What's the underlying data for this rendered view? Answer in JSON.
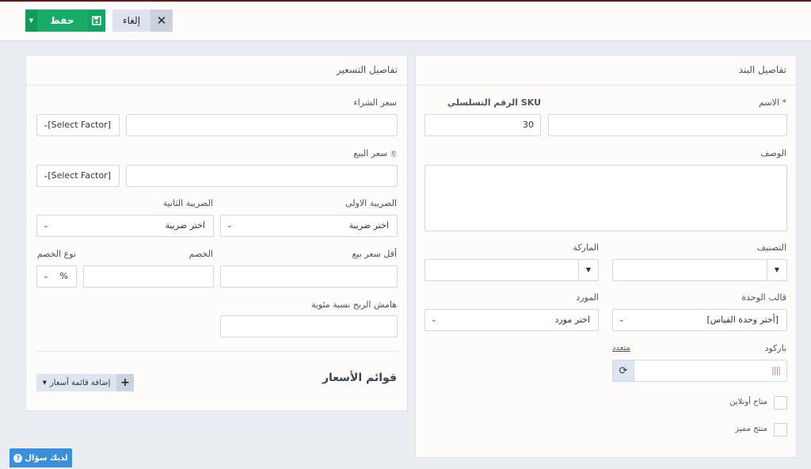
{
  "toolbar": {
    "save_label": "حفظ",
    "cancel_label": "إلغاء"
  },
  "item_details": {
    "title": "تفاصيل البند",
    "name_label": "الاسم *",
    "sku_label": "الرقم التسلسلي SKU",
    "sku_value": "30",
    "description_label": "الوصف",
    "category_label": "التصنيف",
    "brand_label": "الماركة",
    "unit_template_label": "قالب الوحدة",
    "unit_template_value": "[أختر وحدة القياس]",
    "supplier_label": "المورد",
    "supplier_value": "اختر مورد",
    "barcode_label": "باركود",
    "multiple_link": "متعدد",
    "available_online_label": "متاح أونلاين",
    "featured_label": "منتج مميز"
  },
  "pricing": {
    "title": "تفاصيل التسعير",
    "purchase_price_label": "سعر الشراء",
    "sale_price_label": "سعر البيع",
    "help_badge": "؟",
    "factor_placeholder": "[Select Factor]",
    "tax1_label": "الضريبة الاولى",
    "tax2_label": "الضريبة الثانية",
    "tax_value": "اختر ضريبة",
    "min_price_label": "أقل سعر بيع",
    "discount_label": "الخصم",
    "discount_type_label": "نوع الخصم",
    "discount_type_value": "%",
    "margin_label": "هامش الربح نسبة مئوية",
    "price_lists_title": "قوائم الأسعار",
    "add_price_list_label": "إضافة قائمة أسعار"
  },
  "help": {
    "label": "لديك سؤال"
  }
}
